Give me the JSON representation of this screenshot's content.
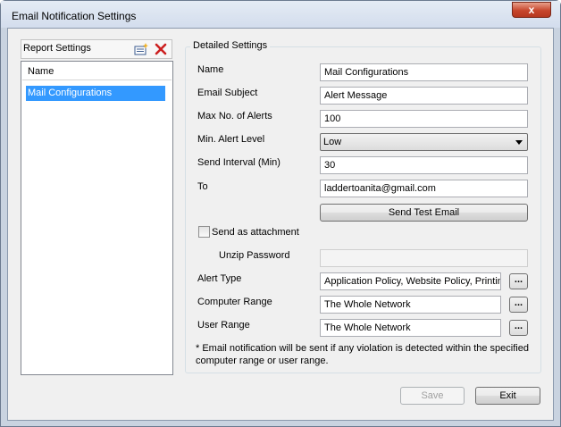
{
  "window": {
    "title": "Email Notification Settings",
    "close_label": "x"
  },
  "report_settings": {
    "header_label": "Report Settings",
    "list_column": "Name",
    "items": [
      "Mail Configurations"
    ]
  },
  "detailed": {
    "group_title": "Detailed Settings",
    "name": {
      "label": "Name",
      "value": "Mail Configurations"
    },
    "email_subject": {
      "label": "Email Subject",
      "value": "Alert Message"
    },
    "max_alerts": {
      "label": "Max No. of Alerts",
      "value": "100"
    },
    "min_level": {
      "label": "Min. Alert Level",
      "value": "Low"
    },
    "send_interval": {
      "label": "Send Interval (Min)",
      "value": "30"
    },
    "to": {
      "label": "To",
      "value": "laddertoanita@gmail.com"
    },
    "send_test_label": "Send Test Email",
    "attachment_label": "Send as attachment",
    "unzip": {
      "label": "Unzip Password",
      "value": ""
    },
    "alert_type": {
      "label": "Alert Type",
      "value": "Application Policy, Website Policy, Printing"
    },
    "computer_range": {
      "label": "Computer Range",
      "value": "The Whole Network"
    },
    "user_range": {
      "label": "User Range",
      "value": "The Whole Network"
    },
    "ellipsis": "...",
    "note": "* Email notification will be sent if any violation is detected within the specified computer range or user range."
  },
  "footer": {
    "save_label": "Save",
    "exit_label": "Exit"
  }
}
